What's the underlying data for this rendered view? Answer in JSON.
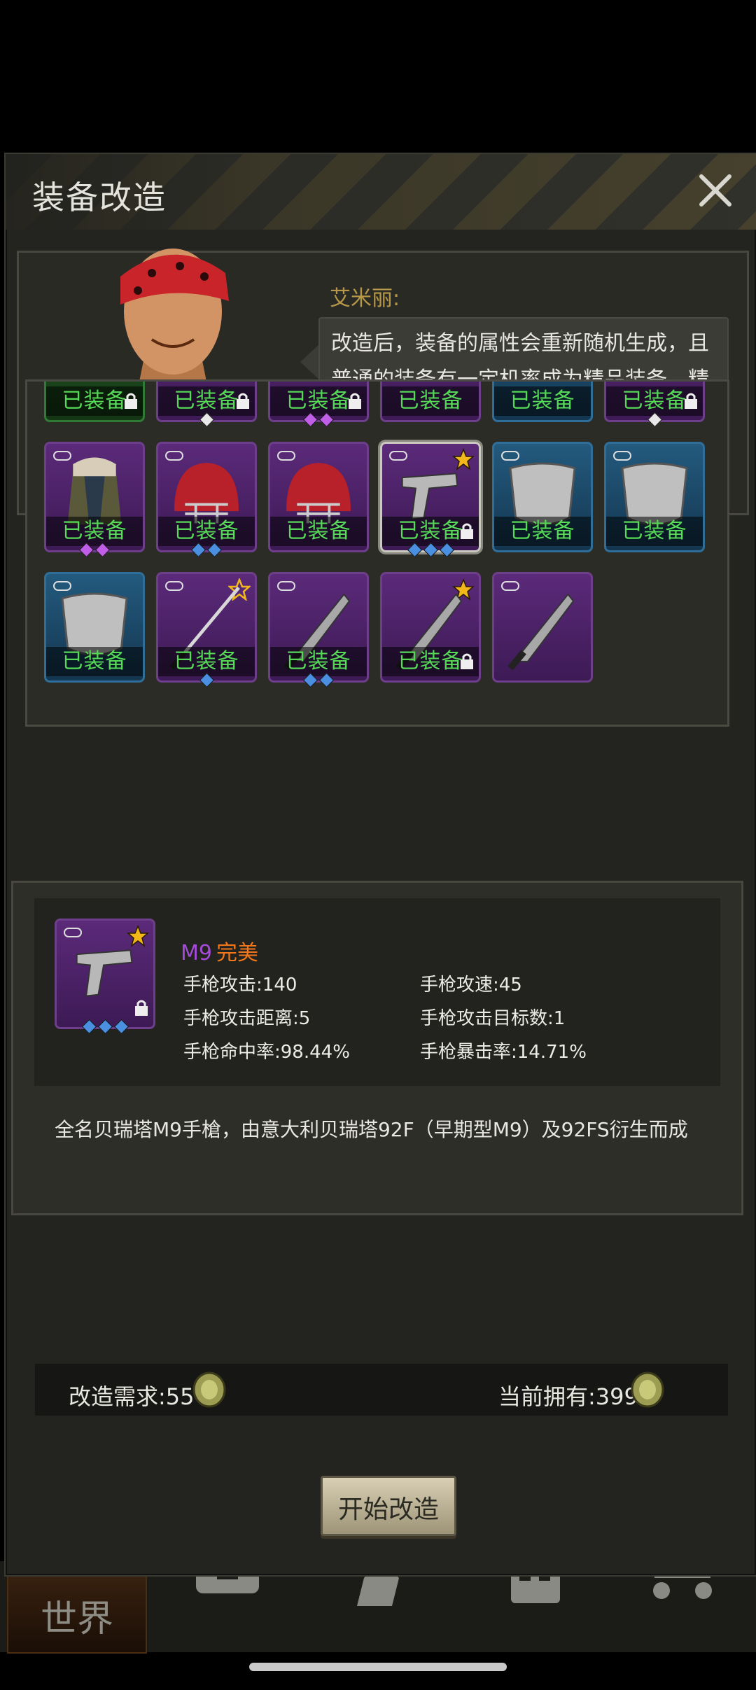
{
  "dialog": {
    "title": "装备改造",
    "close_icon": "close-icon"
  },
  "npc": {
    "name": "艾米丽:",
    "speech": "改造后，装备的属性会重新随机生成，且普通的装备有一定机率成为精品装备，精品的装备有一定机率成为完美装备。"
  },
  "inventory": {
    "equipped_label": "已装备",
    "rows": [
      [
        "green-lock",
        "purple-lock-1w",
        "purple-lock-2p",
        "purple",
        "blue",
        "purple-lock-1w"
      ],
      [
        "coat",
        "helmet",
        "helmet",
        "pistol-selected",
        "shield",
        "shield"
      ],
      [
        "shield",
        "katana",
        "knife",
        "knife-star",
        "knife-unequipped"
      ]
    ]
  },
  "detail": {
    "item_name": "M9",
    "item_quality": "完美",
    "stats": {
      "pistol_attack": "手枪攻击:140",
      "pistol_attack_speed": "手枪攻速:45",
      "pistol_range": "手枪攻击距离:5",
      "pistol_targets": "手枪攻击目标数:1",
      "pistol_accuracy": "手枪命中率:98.44%",
      "pistol_crit": "手枪暴击率:14.71%"
    },
    "description": "全名贝瑞塔M9手槍，由意大利贝瑞塔92F（早期型M9）及92FS衍生而成"
  },
  "requirement": {
    "need_label": "改造需求:55",
    "owned_label": "当前拥有:399"
  },
  "start_button_label": "开始改造",
  "bottom_nav": {
    "world_label": "世界"
  },
  "colors": {
    "equipped_green": "#55d957",
    "quality_orange": "#f2771a",
    "name_purple": "#a44bd8",
    "npc_name_gold": "#b79848"
  }
}
